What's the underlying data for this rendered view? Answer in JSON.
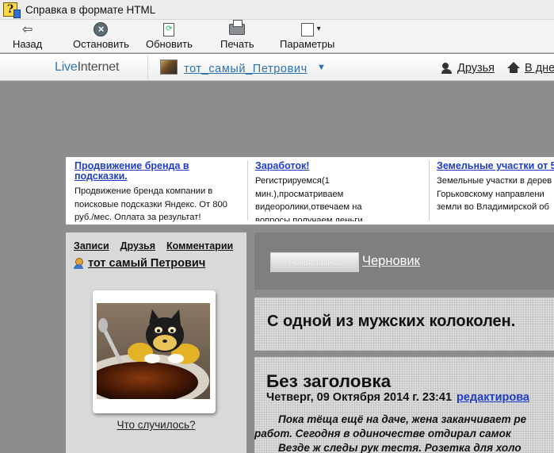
{
  "window": {
    "title": "Справка в формате HTML"
  },
  "toolbar": {
    "back": "Назад",
    "stop": "Остановить",
    "refresh": "Обновить",
    "print": "Печать",
    "options": "Параметры"
  },
  "site_bar": {
    "logo_live": "Live",
    "logo_rest": "Internet",
    "username": "тот_самый_Петрович",
    "friends": "Друзья",
    "home": "В дне"
  },
  "ads": [
    {
      "title_line1": "Продвижение бренда в",
      "title_line2": "подсказки.",
      "lines": [
        "Продвижение бренда компании в",
        "поисковые подсказки Яндекс. От 800",
        "руб./мес. Оплата за результат!"
      ]
    },
    {
      "title_line1": "Заработок!",
      "title_line2": "",
      "lines": [
        "Регистрируемся(1",
        "мин.),просматриваем",
        "видеоролики,отвечаем на",
        "вопросы,получаем деньги"
      ]
    },
    {
      "title_line1": "Земельные участки от 5",
      "title_line2": "",
      "lines": [
        "Земельные участки в дерев",
        "Горьковскому направлени",
        "земли во Владимирской об"
      ]
    }
  ],
  "sidebar": {
    "nav": [
      "Записи",
      "Друзья",
      "Комментарии"
    ],
    "user": "тот самый Петрович",
    "caption": "Что случилось?"
  },
  "post_bar": {
    "new_post": "Новая запись",
    "draft": "Черновик"
  },
  "blog": {
    "description": "С одной из мужских колоколен."
  },
  "post": {
    "title": "Без заголовка",
    "date": "Четверг, 09 Октября 2014 г. 23:41",
    "edit": "редактирова",
    "body": [
      "        Пока тёща ещё на даче, жена заканчивает ре",
      "работ. Сегодня в одиночестве отдирал самок",
      "        Везде ж следы рук тестя. Розетка для холо"
    ]
  }
}
